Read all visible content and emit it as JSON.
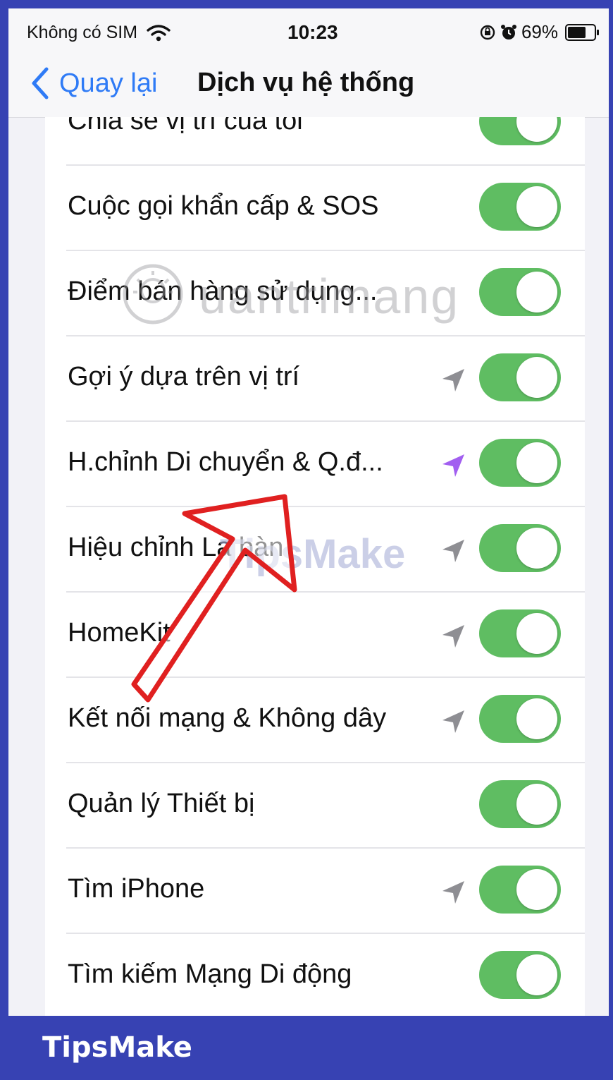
{
  "status_bar": {
    "carrier": "Không có SIM",
    "time": "10:23",
    "battery": "69%",
    "icons": [
      "wifi-icon",
      "screen-lock-icon",
      "alarm-icon",
      "battery-icon"
    ]
  },
  "nav": {
    "back_label": "Quay lại",
    "title": "Dịch vụ hệ thống"
  },
  "rows": [
    {
      "label": "Chia sẻ vị trí của tôi",
      "on": true,
      "location_icon": "none"
    },
    {
      "label": "Cuộc gọi khẩn cấp & SOS",
      "on": true,
      "location_icon": "none"
    },
    {
      "label": "Điểm bán hàng sử dụng...",
      "on": true,
      "location_icon": "none"
    },
    {
      "label": "Gợi ý dựa trên vị trí",
      "on": true,
      "location_icon": "gray"
    },
    {
      "label": "H.chỉnh Di chuyển & Q.đ...",
      "on": true,
      "location_icon": "purple"
    },
    {
      "label": "Hiệu chỉnh La bàn",
      "on": true,
      "location_icon": "gray"
    },
    {
      "label": "HomeKit",
      "on": true,
      "location_icon": "gray"
    },
    {
      "label": "Kết nối mạng & Không dây",
      "on": true,
      "location_icon": "gray"
    },
    {
      "label": "Quản lý Thiết bị",
      "on": true,
      "location_icon": "none"
    },
    {
      "label": "Tìm iPhone",
      "on": true,
      "location_icon": "gray"
    },
    {
      "label": "Tìm kiếm Mạng Di động",
      "on": true,
      "location_icon": "none"
    }
  ],
  "watermarks": {
    "primary": "uantrimang",
    "secondary": "TipsMake"
  },
  "footer": {
    "brand": "TipsMake"
  },
  "colors": {
    "toggle_on": "#5fbd62",
    "ios_blue": "#2f7bf6",
    "location_gray": "#8e8e93",
    "location_purple": "#a25ff0",
    "annotation_red": "#e02020",
    "frame": "#3742b3"
  }
}
